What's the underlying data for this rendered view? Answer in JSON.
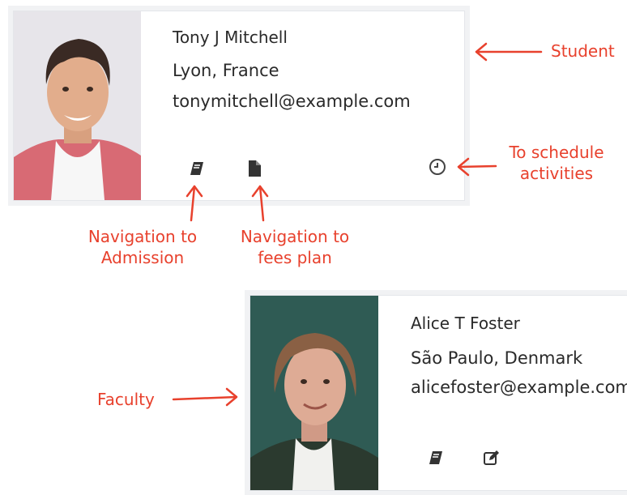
{
  "student": {
    "name": "Tony J Mitchell",
    "location": "Lyon, France",
    "email": "tonymitchell@example.com"
  },
  "faculty": {
    "name": "Alice T Foster",
    "location": "São Paulo, Denmark",
    "email": "alicefoster@example.com"
  },
  "annotations": {
    "student": "Student",
    "faculty": "Faculty",
    "schedule": "To schedule activities",
    "admission": "Navigation to Admission",
    "fees": "Navigation to fees plan"
  },
  "icons": {
    "admission": "book-icon",
    "fees": "file-icon",
    "schedule": "clock-icon",
    "edit": "edit-icon"
  },
  "colors": {
    "annotation": "#e8412d",
    "icon": "#333333"
  }
}
